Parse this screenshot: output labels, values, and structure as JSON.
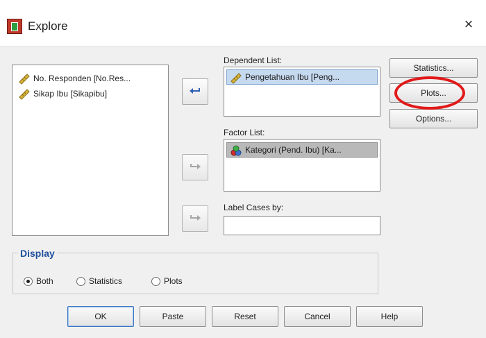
{
  "window": {
    "title": "Explore",
    "close_glyph": "×"
  },
  "source_list": {
    "items": [
      {
        "label": "No. Responden [No.Res...",
        "icon": "ruler-icon"
      },
      {
        "label": "Sikap Ibu [Sikapibu]",
        "icon": "ruler-icon"
      }
    ]
  },
  "dependent_list": {
    "label": "Dependent List:",
    "items": [
      {
        "label": "Pengetahuan Ibu [Peng...",
        "icon": "ruler-icon"
      }
    ]
  },
  "factor_list": {
    "label": "Factor List:",
    "items": [
      {
        "label": "Kategori (Pend. Ibu) [Ka...",
        "icon": "nominal-icon"
      }
    ]
  },
  "label_cases": {
    "label": "Label Cases by:",
    "value": ""
  },
  "side_buttons": {
    "statistics": "Statistics...",
    "plots": "Plots...",
    "options": "Options..."
  },
  "display": {
    "legend": "Display",
    "options": [
      {
        "label": "Both",
        "selected": true
      },
      {
        "label": "Statistics",
        "selected": false
      },
      {
        "label": "Plots",
        "selected": false
      }
    ]
  },
  "bottom_buttons": {
    "ok": "OK",
    "paste": "Paste",
    "reset": "Reset",
    "cancel": "Cancel",
    "help": "Help"
  },
  "colors": {
    "accent_blue": "#4472c4",
    "highlight_red": "#e11919",
    "display_legend": "#1f4f9c"
  }
}
